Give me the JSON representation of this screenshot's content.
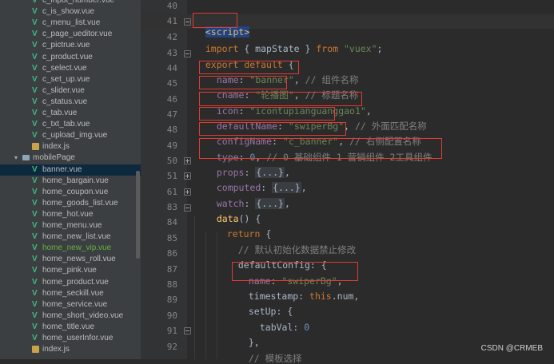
{
  "project_tree": {
    "files_top": [
      "c_input_number.vue",
      "c_is_show.vue",
      "c_menu_list.vue",
      "c_page_ueditor.vue",
      "c_pictrue.vue",
      "c_product.vue",
      "c_select.vue",
      "c_set_up.vue",
      "c_slider.vue",
      "c_status.vue",
      "c_tab.vue",
      "c_txt_tab.vue",
      "c_upload_img.vue"
    ],
    "index_js_1": "index.js",
    "folder": "mobilePage",
    "files_mobile": [
      "banner.vue",
      "home_bargain.vue",
      "home_coupon.vue",
      "home_goods_list.vue",
      "home_hot.vue",
      "home_menu.vue",
      "home_new_list.vue",
      "home_new_vip.vue",
      "home_news_roll.vue",
      "home_pink.vue",
      "home_product.vue",
      "home_seckill.vue",
      "home_service.vue",
      "home_short_video.vue",
      "home_title.vue",
      "home_userInfor.vue"
    ],
    "index_js_2": "index.js",
    "selected": "banner.vue",
    "highlighted": "home_new_vip.vue"
  },
  "line_numbers": [
    "40",
    "41",
    "42",
    "43",
    "44",
    "45",
    "46",
    "47",
    "48",
    "49",
    "50",
    "51",
    "61",
    "83",
    "84",
    "85",
    "86",
    "87",
    "88",
    "89",
    "90",
    "91",
    "92"
  ],
  "code": {
    "l41_tag": "<script>",
    "l42_import": "import",
    "l42_brace": " { mapState } ",
    "l42_from": "from",
    "l42_mod": "\"vuex\"",
    "l43_export": "export default",
    "l43_rest": " {",
    "l44_key": "name",
    "l44_val": "\"banner\"",
    "l44_cmt": "// 组件名称",
    "l45_key": "cname",
    "l45_val": "\"轮播图\"",
    "l45_cmt": "// 标题名称",
    "l46_key": "icon",
    "l46_val": "\"icontupianguanggao1\"",
    "l47_key": "defaultName",
    "l47_val": "\"swiperBg\"",
    "l47_cmt": "// 外面匹配名称",
    "l48_key": "configName",
    "l48_val": "\"c_banner\"",
    "l48_cmt": "// 右侧配置名称",
    "l49_key": "type",
    "l49_val": "0",
    "l49_cmt": "// 0 基础组件 1 营销组件 2工具组件",
    "l50_key": "props",
    "l51_key": "computed",
    "l61_key": "watch",
    "fold_placeholder": "{...}",
    "l83_fn": "data",
    "l83_rest": "() {",
    "l84_return": "return",
    "l84_rest": " {",
    "l85_cmt": "// 默认初始化数据禁止修改",
    "l86_key": "defaultConfig",
    "l86_rest": ": {",
    "l87_key": "name",
    "l87_val": "\"swiperBg\"",
    "l88_key": "timestamp",
    "l88_this": "this",
    "l88_rest": ".num,",
    "l89_key": "setUp",
    "l89_rest": ": {",
    "l90_key": "tabVal",
    "l90_val": "0",
    "l91_rest": "},",
    "l92_cmt": "// 模板选择"
  },
  "watermark": "CSDN @CRMEB",
  "colors": {
    "highlight_box": "#e03c31",
    "keyword": "#cc7832",
    "string": "#6a8759",
    "property": "#9876aa",
    "comment": "#808080"
  }
}
